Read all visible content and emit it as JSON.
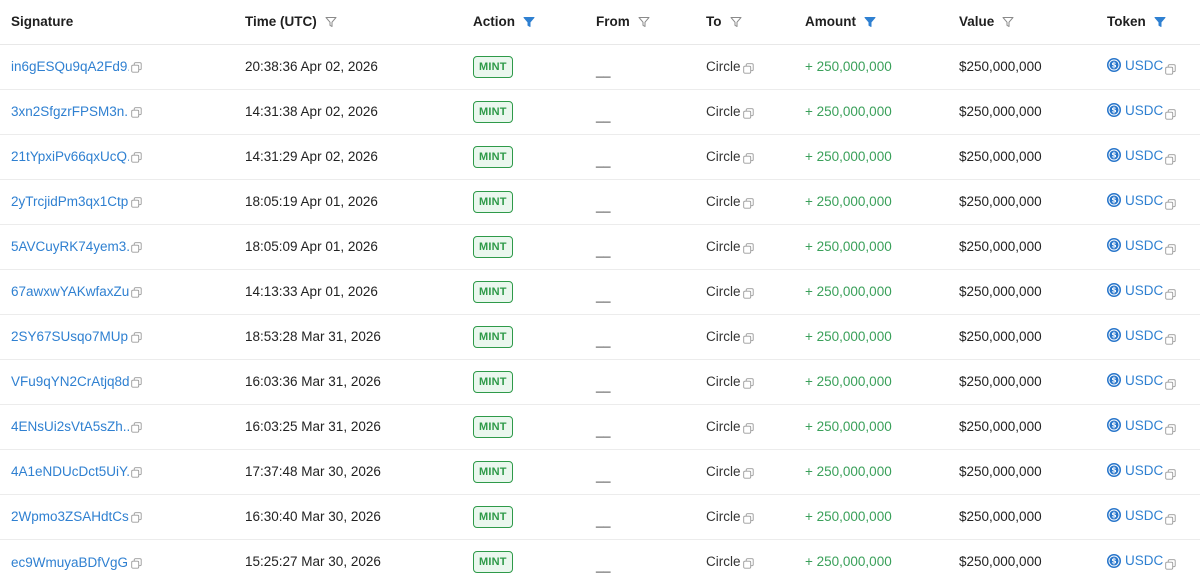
{
  "table": {
    "columns": [
      {
        "key": "signature",
        "label": "Signature",
        "filter": "none"
      },
      {
        "key": "time",
        "label": "Time (UTC)",
        "filter": "inactive"
      },
      {
        "key": "action",
        "label": "Action",
        "filter": "active"
      },
      {
        "key": "from",
        "label": "From",
        "filter": "inactive"
      },
      {
        "key": "to",
        "label": "To",
        "filter": "inactive"
      },
      {
        "key": "amount",
        "label": "Amount",
        "filter": "active"
      },
      {
        "key": "value",
        "label": "Value",
        "filter": "inactive"
      },
      {
        "key": "token",
        "label": "Token",
        "filter": "active"
      }
    ],
    "rows": [
      {
        "signature": "in6gESQu9qA2Fd9...",
        "time": "20:38:36 Apr 02, 2026",
        "action": "MINT",
        "from": "__",
        "to": "Circle",
        "amount": "+ 250,000,000",
        "value": "$250,000,000",
        "token": "USDC"
      },
      {
        "signature": "3xn2SfgzrFPSM3n...",
        "time": "14:31:38 Apr 02, 2026",
        "action": "MINT",
        "from": "__",
        "to": "Circle",
        "amount": "+ 250,000,000",
        "value": "$250,000,000",
        "token": "USDC"
      },
      {
        "signature": "21tYpxiPv66qxUcQ...",
        "time": "14:31:29 Apr 02, 2026",
        "action": "MINT",
        "from": "__",
        "to": "Circle",
        "amount": "+ 250,000,000",
        "value": "$250,000,000",
        "token": "USDC"
      },
      {
        "signature": "2yTrcjidPm3qx1Ctp...",
        "time": "18:05:19 Apr 01, 2026",
        "action": "MINT",
        "from": "__",
        "to": "Circle",
        "amount": "+ 250,000,000",
        "value": "$250,000,000",
        "token": "USDC"
      },
      {
        "signature": "5AVCuyRK74yem3...",
        "time": "18:05:09 Apr 01, 2026",
        "action": "MINT",
        "from": "__",
        "to": "Circle",
        "amount": "+ 250,000,000",
        "value": "$250,000,000",
        "token": "USDC"
      },
      {
        "signature": "67awxwYAKwfaxZu...",
        "time": "14:13:33 Apr 01, 2026",
        "action": "MINT",
        "from": "__",
        "to": "Circle",
        "amount": "+ 250,000,000",
        "value": "$250,000,000",
        "token": "USDC"
      },
      {
        "signature": "2SY67SUsqo7MUp...",
        "time": "18:53:28 Mar 31, 2026",
        "action": "MINT",
        "from": "__",
        "to": "Circle",
        "amount": "+ 250,000,000",
        "value": "$250,000,000",
        "token": "USDC"
      },
      {
        "signature": "VFu9qYN2CrAtjq8d...",
        "time": "16:03:36 Mar 31, 2026",
        "action": "MINT",
        "from": "__",
        "to": "Circle",
        "amount": "+ 250,000,000",
        "value": "$250,000,000",
        "token": "USDC"
      },
      {
        "signature": "4ENsUi2sVtA5sZh...",
        "time": "16:03:25 Mar 31, 2026",
        "action": "MINT",
        "from": "__",
        "to": "Circle",
        "amount": "+ 250,000,000",
        "value": "$250,000,000",
        "token": "USDC"
      },
      {
        "signature": "4A1eNDUcDct5UiY...",
        "time": "17:37:48 Mar 30, 2026",
        "action": "MINT",
        "from": "__",
        "to": "Circle",
        "amount": "+ 250,000,000",
        "value": "$250,000,000",
        "token": "USDC"
      },
      {
        "signature": "2Wpmo3ZSAHdtCs...",
        "time": "16:30:40 Mar 30, 2026",
        "action": "MINT",
        "from": "__",
        "to": "Circle",
        "amount": "+ 250,000,000",
        "value": "$250,000,000",
        "token": "USDC"
      },
      {
        "signature": "ec9WmuyaBDfVgG...",
        "time": "15:25:27 Mar 30, 2026",
        "action": "MINT",
        "from": "__",
        "to": "Circle",
        "amount": "+ 250,000,000",
        "value": "$250,000,000",
        "token": "USDC"
      }
    ]
  },
  "colors": {
    "link": "#2f80d1",
    "amount_positive": "#3aa05a",
    "badge_green": "#2e9a49",
    "filter_active": "#2f80d1",
    "filter_inactive": "#8a8a8a"
  },
  "icons": {
    "filter": "funnel-icon",
    "copy": "copy-icon",
    "token": "usdc-coin-icon"
  }
}
